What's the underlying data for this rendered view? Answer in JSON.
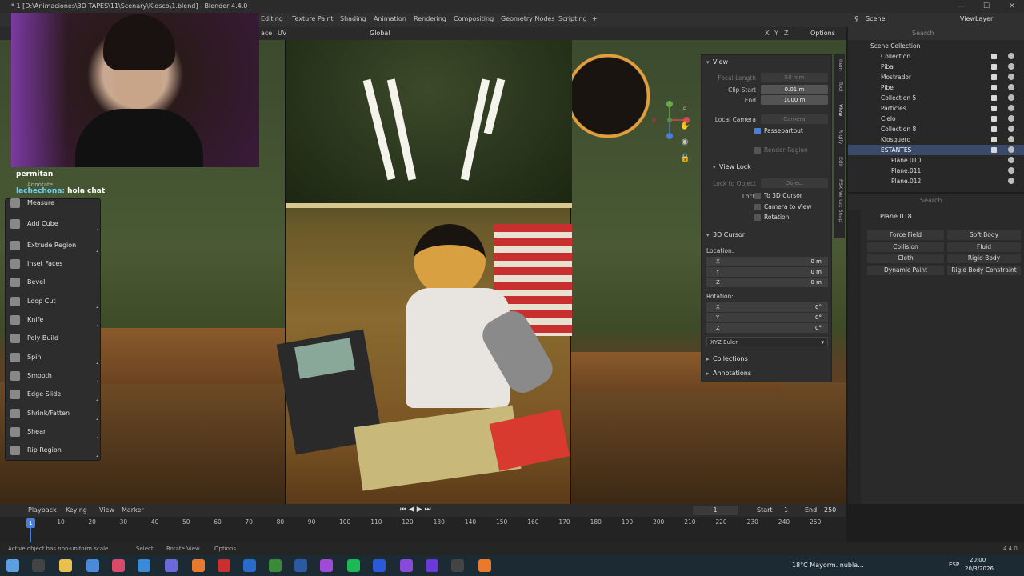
{
  "window": {
    "title": "* 1 [D:\\Animaciones\\3D TAPES\\11\\Scenary\\Kiosco\\1.blend] - Blender 4.4.0",
    "min": "—",
    "max": "☐",
    "close": "✕"
  },
  "workspaces": [
    "Editing",
    "Texture Paint",
    "Shading",
    "Animation",
    "Rendering",
    "Compositing",
    "Geometry Nodes",
    "Scripting",
    "+"
  ],
  "viewport_header": {
    "mode_frag": "ace",
    "uv": "UV",
    "orientation": "Global",
    "options": "Options",
    "axes": [
      "X",
      "Y",
      "Z"
    ]
  },
  "chat": {
    "line1": "permitan",
    "user": "lachechona:",
    "message": " hola chat"
  },
  "tools": [
    {
      "label": "Annotate"
    },
    {
      "label": "Measure"
    },
    {
      "label": "Add Cube"
    },
    {
      "label": "Extrude Region"
    },
    {
      "label": "Inset Faces"
    },
    {
      "label": "Bevel"
    },
    {
      "label": "Loop Cut"
    },
    {
      "label": "Knife"
    },
    {
      "label": "Poly Build"
    },
    {
      "label": "Spin"
    },
    {
      "label": "Smooth"
    },
    {
      "label": "Edge Slide"
    },
    {
      "label": "Shrink/Fatten"
    },
    {
      "label": "Shear"
    },
    {
      "label": "Rip Region"
    }
  ],
  "npanel": {
    "view": "View",
    "focal_length": "Focal Length",
    "focal_length_val": "50 mm",
    "clip_start": "Clip Start",
    "clip_start_val": "0.01 m",
    "end": "End",
    "end_val": "1000 m",
    "local_camera": "Local Camera",
    "camera": "Camera",
    "passepartout": "Passepartout",
    "render_region": "Render Region",
    "view_lock": "View Lock",
    "lock_to_object": "Lock to Object",
    "object": "Object",
    "lock": "Lock",
    "to_3d_cursor": "To 3D Cursor",
    "camera_to_view": "Camera to View",
    "rotation_chk": "Rotation",
    "cursor": "3D Cursor",
    "location": "Location:",
    "rotation": "Rotation:",
    "loc": [
      {
        "k": "X",
        "v": "0 m"
      },
      {
        "k": "Y",
        "v": "0 m"
      },
      {
        "k": "Z",
        "v": "0 m"
      }
    ],
    "rot": [
      {
        "k": "X",
        "v": "0°"
      },
      {
        "k": "Y",
        "v": "0°"
      },
      {
        "k": "Z",
        "v": "0°"
      }
    ],
    "euler": "XYZ Euler",
    "collections": "Collections",
    "annotations": "Annotations"
  },
  "sidetabs": [
    "Item",
    "Tool",
    "View",
    "Rigify",
    "Edit",
    "PSX Vertex Snap"
  ],
  "scene": {
    "scene": "Scene",
    "viewlayer": "ViewLayer",
    "search": "Search"
  },
  "outliner": [
    {
      "name": "Scene Collection",
      "indent": 0
    },
    {
      "name": "Collection",
      "indent": 1
    },
    {
      "name": "Piba",
      "indent": 1
    },
    {
      "name": "Mostrador",
      "indent": 1
    },
    {
      "name": "Pibe",
      "indent": 1
    },
    {
      "name": "Collection 5",
      "indent": 1
    },
    {
      "name": "Particles",
      "indent": 1
    },
    {
      "name": "Cielo",
      "indent": 1
    },
    {
      "name": "Collection 8",
      "indent": 1
    },
    {
      "name": "Kiosquero",
      "indent": 1
    },
    {
      "name": "ESTANTES",
      "indent": 1
    },
    {
      "name": "Plane.010",
      "indent": 2
    },
    {
      "name": "Plane.011",
      "indent": 2
    },
    {
      "name": "Plane.012",
      "indent": 2
    }
  ],
  "properties": {
    "object": "Plane.018",
    "buttons": [
      "Force Field",
      "Soft Body",
      "Collision",
      "Fluid",
      "Cloth",
      "Rigid Body",
      "Dynamic Paint",
      "Rigid Body Constraint"
    ]
  },
  "timeline": {
    "playback": "Playback",
    "keying": "Keying",
    "view": "View",
    "marker": "Marker",
    "current": "1",
    "start_lbl": "Start",
    "start": "1",
    "end_lbl": "End",
    "end": "250",
    "frames": [
      "10",
      "20",
      "30",
      "40",
      "50",
      "60",
      "70",
      "80",
      "90",
      "100",
      "110",
      "120",
      "130",
      "140",
      "150",
      "160",
      "170",
      "180",
      "190",
      "200",
      "210",
      "220",
      "230",
      "240",
      "250"
    ],
    "playhead": "1"
  },
  "status": {
    "warning": "Active object has non-uniform scale",
    "select": "Select",
    "rotate": "Rotate View",
    "options": "Options",
    "version": "4.4.0"
  },
  "taskbar": {
    "weather": "18°C  Mayorm. nubla...",
    "lang": "ESP",
    "time": "20:00",
    "date": "20/3/2026"
  }
}
